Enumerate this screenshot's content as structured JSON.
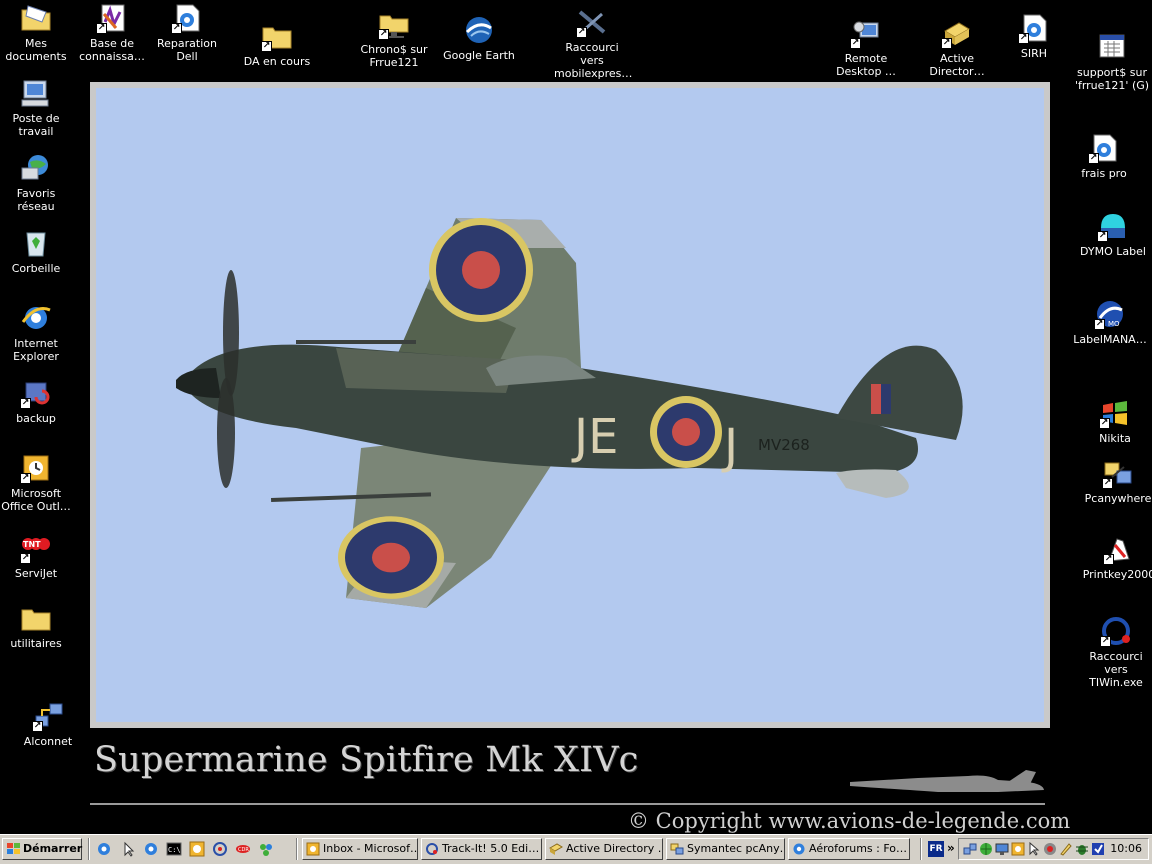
{
  "desktop": {
    "left_icons": [
      {
        "name": "mes-documents",
        "label": "Mes\ndocuments",
        "icon": "folder-letter-icon"
      },
      {
        "name": "poste-de-travail",
        "label": "Poste de\ntravail",
        "icon": "computer-icon"
      },
      {
        "name": "favoris-reseau",
        "label": "Favoris réseau",
        "icon": "network-globe-icon"
      },
      {
        "name": "corbeille",
        "label": "Corbeille",
        "icon": "recycle-bin-icon"
      },
      {
        "name": "internet-explorer",
        "label": "Internet\nExplorer",
        "icon": "ie-icon"
      },
      {
        "name": "backup",
        "label": "backup",
        "icon": "backup-icon"
      },
      {
        "name": "microsoft-office-outlook",
        "label": "Microsoft\nOffice Outl…",
        "icon": "outlook-icon"
      },
      {
        "name": "servijet",
        "label": "ServiJet",
        "icon": "tnt-icon"
      },
      {
        "name": "utilitaires",
        "label": "utilitaires",
        "icon": "folder-icon"
      },
      {
        "name": "alconnet",
        "label": "Alconnet",
        "icon": "network-connection-icon"
      }
    ],
    "top_icons": [
      {
        "name": "base-de-connaissance",
        "label": "Base de\nconnaissa…",
        "icon": "knowledge-base-icon"
      },
      {
        "name": "reparation-dell",
        "label": "Reparation\nDell",
        "icon": "ie-document-icon"
      },
      {
        "name": "da-en-cours",
        "label": "DA en cours",
        "icon": "folder-icon"
      },
      {
        "name": "chrono-sur-frrue121",
        "label": "Chrono$ sur\nFrrue121",
        "icon": "network-folder-icon"
      },
      {
        "name": "google-earth",
        "label": "Google Earth",
        "icon": "google-earth-icon"
      },
      {
        "name": "raccourci-mobilexpres",
        "label": "Raccourci vers\nmobilexpres…",
        "icon": "airplane-icon"
      },
      {
        "name": "remote-desktop",
        "label": "Remote\nDesktop …",
        "icon": "remote-desktop-icon"
      },
      {
        "name": "active-directory",
        "label": "Active\nDirector…",
        "icon": "active-directory-icon"
      },
      {
        "name": "sirh",
        "label": "SIRH",
        "icon": "ie-document-icon"
      }
    ],
    "right_icons": [
      {
        "name": "support-sur-frrue121",
        "label": "support$ sur\n'frrue121' (G)",
        "icon": "network-drive-icon"
      },
      {
        "name": "frais-pro",
        "label": "frais pro",
        "icon": "ie-document-icon"
      },
      {
        "name": "dymo-label",
        "label": "DYMO Label",
        "icon": "dymo-icon"
      },
      {
        "name": "labelmanager",
        "label": "LabelMANA…",
        "icon": "dymo-labelmanager-icon"
      },
      {
        "name": "nikita",
        "label": "Nikita",
        "icon": "windows-flag-icon"
      },
      {
        "name": "pcanywhere",
        "label": "Pcanywhere",
        "icon": "pcanywhere-icon"
      },
      {
        "name": "printkey2000",
        "label": "Printkey2000",
        "icon": "printkey-icon"
      },
      {
        "name": "raccourci-tiwin",
        "label": "Raccourci vers\nTIWin.exe",
        "icon": "tiwin-icon"
      }
    ]
  },
  "wallpaper": {
    "title": "Supermarine Spitfire Mk XIVc",
    "copyright": "© Copyright www.avions-de-legende.com",
    "fuselage_code": "JE",
    "fuselage_letter": "J",
    "serial": "MV268",
    "sky_color": "#b3c9ef"
  },
  "taskbar": {
    "start_label": "Démarrer",
    "quick_launch": [
      "ie-quicklaunch-icon",
      "pointer-quicklaunch-icon",
      "ie-quicklaunch-icon",
      "cmd-quicklaunch-icon",
      "clock-quicklaunch-icon",
      "network-quicklaunch-icon",
      "cdr-quicklaunch-icon",
      "msn-quicklaunch-icon"
    ],
    "tasks": [
      {
        "label": "Inbox - Microsof…",
        "icon": "outlook-task-icon"
      },
      {
        "label": "Track-It! 5.0 Edi…",
        "icon": "trackit-task-icon"
      },
      {
        "label": "Active Directory …",
        "icon": "active-directory-task-icon"
      },
      {
        "label": "Symantec pcAny…",
        "icon": "pcanywhere-task-icon"
      },
      {
        "label": "Aéroforums : Fo…",
        "icon": "ie-task-icon"
      }
    ],
    "language": "FR",
    "clock": "10:06"
  }
}
